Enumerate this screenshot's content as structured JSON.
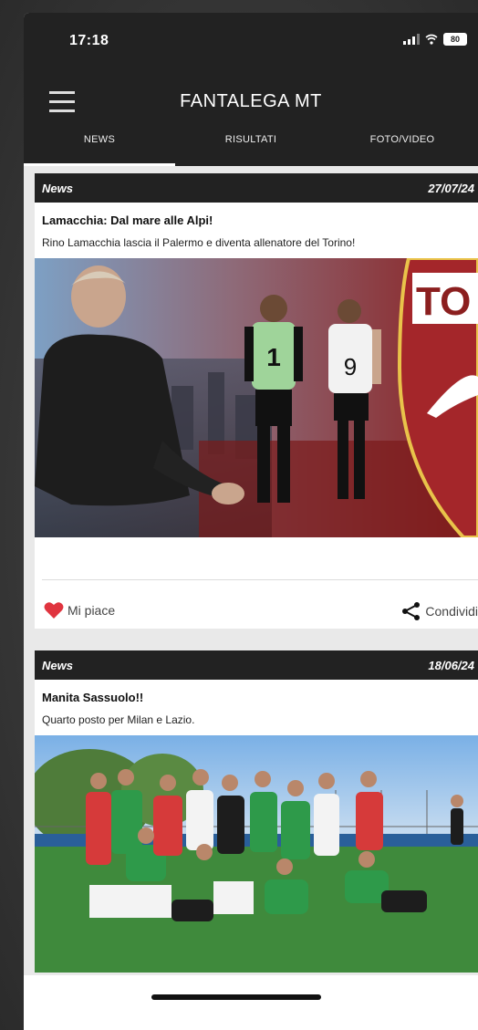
{
  "status": {
    "time": "17:18",
    "battery": "80"
  },
  "app": {
    "title": "FANTALEGA MT"
  },
  "tabs": [
    {
      "label": "NEWS",
      "active": true
    },
    {
      "label": "RISULTATI",
      "active": false
    },
    {
      "label": "FOTO/VIDEO",
      "active": false
    }
  ],
  "cards": [
    {
      "category": "News",
      "date": "27/07/24",
      "title": "Lamacchia: Dal mare alle Alpi!",
      "subtitle": "Rino Lamacchia lascia il Palermo e diventa allenatore del Torino!",
      "image": {
        "badge_text": "TO",
        "jersey_numbers": [
          "1",
          "9"
        ]
      },
      "like_label": "Mi piace",
      "share_label": "Condividi"
    },
    {
      "category": "News",
      "date": "18/06/24",
      "title": "Manita Sassuolo!!",
      "subtitle": "Quarto posto per Milan e Lazio."
    }
  ],
  "colors": {
    "header_bg": "#222222",
    "like_heart": "#e0343f",
    "torino_red": "#8b1f1f"
  }
}
